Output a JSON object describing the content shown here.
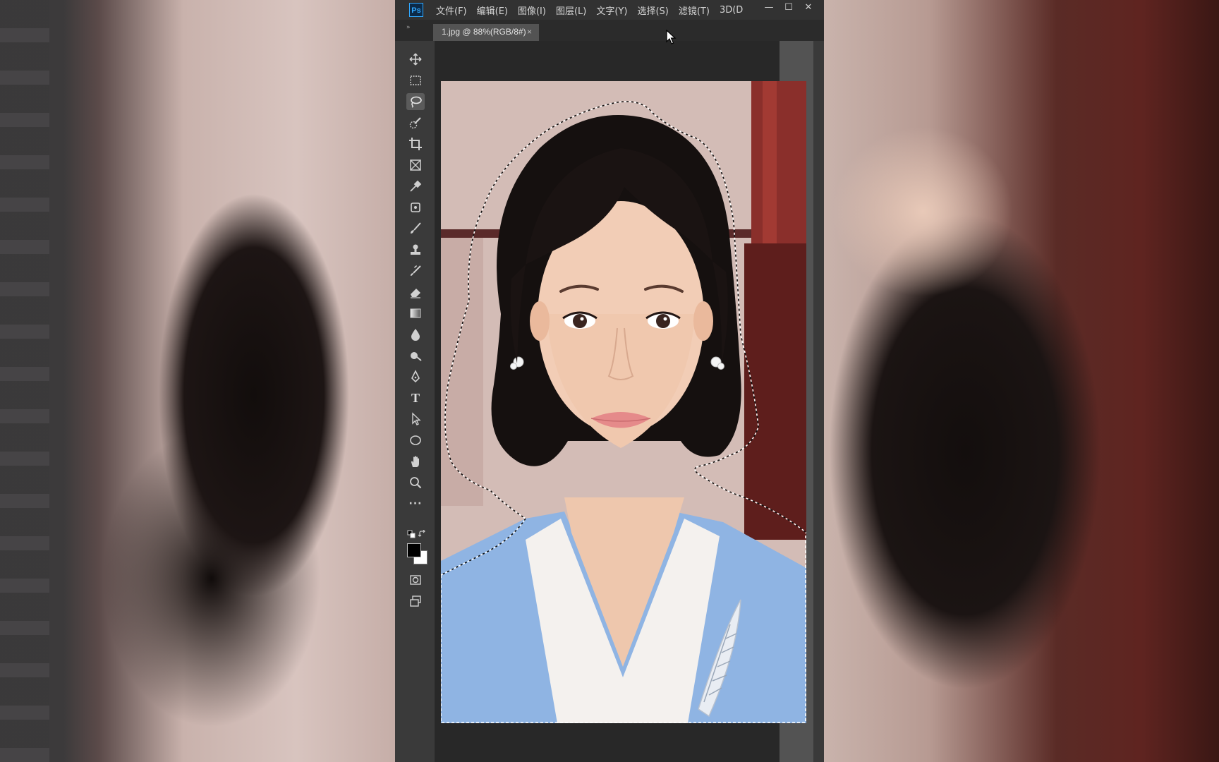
{
  "app": {
    "logo_text": "Ps",
    "menu": [
      "文件(F)",
      "编辑(E)",
      "图像(I)",
      "图层(L)",
      "文字(Y)",
      "选择(S)",
      "滤镜(T)",
      "3D(D"
    ],
    "window_controls": {
      "minimize": "—",
      "maximize": "☐",
      "close": "✕"
    }
  },
  "tabs": {
    "collapse_glyph": "»",
    "document_tab_label": "1.jpg @ 88%(RGB/8#)",
    "document_tab_close": "×"
  },
  "toolbar": {
    "tools": [
      {
        "icon": "move-icon"
      },
      {
        "icon": "marquee-icon"
      },
      {
        "icon": "lasso-icon",
        "active": true
      },
      {
        "icon": "quick-select-icon"
      },
      {
        "icon": "crop-icon"
      },
      {
        "icon": "frame-icon"
      },
      {
        "icon": "eyedropper-icon"
      },
      {
        "icon": "spot-healing-icon"
      },
      {
        "icon": "brush-icon"
      },
      {
        "icon": "clone-stamp-icon"
      },
      {
        "icon": "history-brush-icon"
      },
      {
        "icon": "eraser-icon"
      },
      {
        "icon": "gradient-icon"
      },
      {
        "icon": "blur-icon"
      },
      {
        "icon": "dodge-icon"
      },
      {
        "icon": "pen-icon"
      },
      {
        "icon": "type-icon",
        "glyph": "T"
      },
      {
        "icon": "path-select-icon"
      },
      {
        "icon": "ellipse-icon"
      },
      {
        "icon": "hand-icon"
      },
      {
        "icon": "zoom-icon"
      },
      {
        "icon": "more-tools-icon",
        "glyph": "···"
      }
    ],
    "foreground_color": "#000000",
    "background_color": "#ffffff"
  },
  "colors": {
    "menubar": "#323232",
    "panel": "#3a3a3a",
    "canvas_bg": "#282828",
    "selection_outline": "#ffffff",
    "jacket_blue": "#8fb4e3"
  }
}
